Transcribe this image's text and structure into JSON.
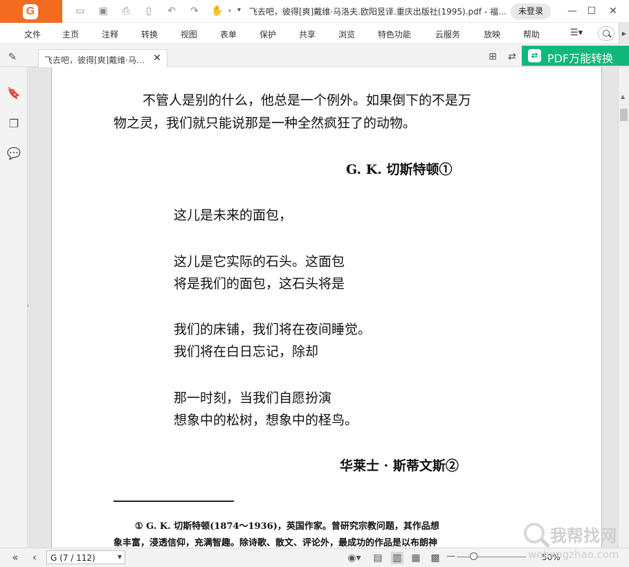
{
  "titlebar": {
    "logo": "G",
    "title": "飞去吧，彼得[爽]戴维·马洛夫.欧阳昱译.重庆出版社(1995).pdf - 福…",
    "login_label": "未登录",
    "quick_access_icons": [
      "open-folder-icon",
      "save-icon",
      "print-icon",
      "new-icon",
      "undo-icon",
      "redo-icon",
      "hand-tool-icon"
    ]
  },
  "menu": {
    "items": [
      "文件",
      "主页",
      "注释",
      "转换",
      "视图",
      "表单",
      "保护",
      "共享",
      "浏览",
      "特色功能",
      "云服务",
      "放映",
      "帮助"
    ]
  },
  "tabs": {
    "active_tab": "飞去吧，彼得[爽]戴维·马…",
    "pdf_convert_label": "PDF万能转换"
  },
  "page": {
    "lines": [
      "不管人是别的什么，他总是一个例外。如果倒下的不是万",
      "物之灵，我们就只能说那是一种全然疯狂了的动物。",
      "G. K. 切斯特顿①",
      "这儿是未来的面包，",
      "这儿是它实际的石头。这面包",
      "将是我们的面包，这石头将是",
      "我们的床铺，我们将在夜间睡觉。",
      "我们将在白日忘记，除却",
      "那一时刻，当我们自愿扮演",
      "想象中的松树，想象中的柽鸟。",
      "华莱士 · 斯蒂文斯②"
    ],
    "footnotes": [
      "① G. K. 切斯特顿(1874～1936)，英国作家。曾研究宗教问题，其作品想",
      "象丰富，浸透信仰，充满智趣。除诗歌、散文、评论外，最成功的作品是以布朗神"
    ]
  },
  "status": {
    "page_indicator": "G (7 / 112)",
    "zoom": "50%"
  },
  "watermark": {
    "cn": "我帮找网",
    "url": "wobangzhao.com"
  },
  "colors": {
    "brand_orange": "#f26c21",
    "convert_green": "#11b77b"
  }
}
